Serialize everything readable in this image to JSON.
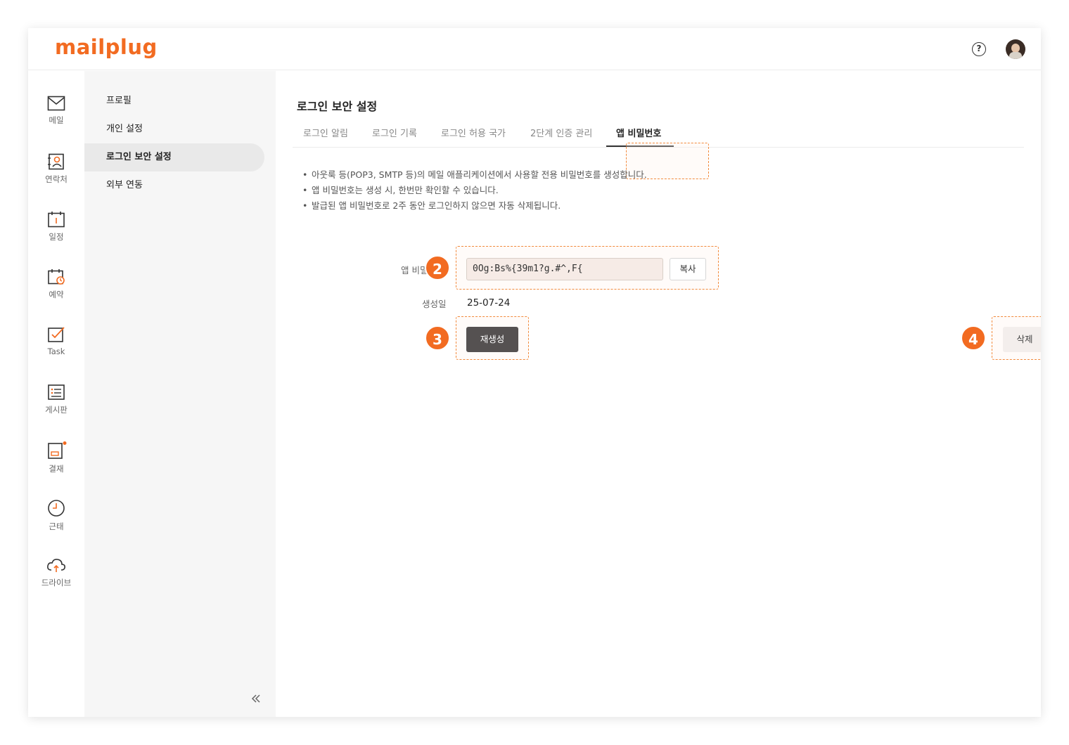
{
  "header": {
    "logo": "mailplug",
    "help_glyph": "?",
    "icons": [
      "help-icon",
      "avatar"
    ]
  },
  "rail": {
    "items": [
      {
        "label": "메일",
        "icon": "mail-icon"
      },
      {
        "label": "연락처",
        "icon": "contacts-icon"
      },
      {
        "label": "일정",
        "icon": "calendar-icon"
      },
      {
        "label": "예약",
        "icon": "reservation-icon"
      },
      {
        "label": "Task",
        "icon": "task-icon"
      },
      {
        "label": "게시판",
        "icon": "board-icon"
      },
      {
        "label": "결재",
        "icon": "approval-icon"
      },
      {
        "label": "근태",
        "icon": "attendance-icon"
      },
      {
        "label": "드라이브",
        "icon": "drive-icon"
      }
    ]
  },
  "subnav": {
    "items": [
      {
        "label": "프로필"
      },
      {
        "label": "개인 설정"
      },
      {
        "label": "로그인 보안 설정"
      },
      {
        "label": "외부 연동"
      }
    ],
    "active_index": 2
  },
  "main": {
    "title": "로그인 보안 설정",
    "tabs": [
      {
        "label": "로그인 알림"
      },
      {
        "label": "로그인 기록"
      },
      {
        "label": "로그인 허용 국가"
      },
      {
        "label": "2단계 인증 관리"
      },
      {
        "label": "앱 비밀번호"
      }
    ],
    "active_tab": 4,
    "bullets": [
      "아웃룩 등(POP3, SMTP 등)의 메일 애플리케이션에서 사용할 전용 비밀번호를 생성합니다.",
      "앱 비밀번호는 생성 시, 한번만 확인할 수 있습니다.",
      "발급된 앱 비밀번호로 2주 동안 로그인하지 않으면 자동 삭제됩니다."
    ],
    "password_label": "앱 비밀",
    "password_value": "0Og:Bs%{39m1?g.#^,F{",
    "copy_label": "복사",
    "created_label": "생성일",
    "created_value": "25-07-24",
    "regenerate_label": "재생성",
    "delete_label": "삭제"
  },
  "annotations": {
    "badges": [
      "2",
      "3",
      "4"
    ],
    "color": "#f26b21"
  },
  "colors": {
    "brand": "#f26b21",
    "regen_button": "#555151",
    "notification_dot": "#f26b21"
  }
}
